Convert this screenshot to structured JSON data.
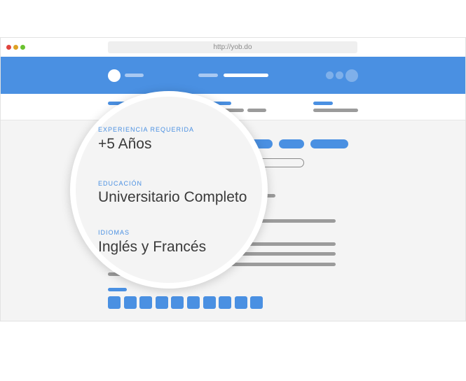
{
  "browser": {
    "url": "http://yob.do",
    "controls": {
      "close": "#e0443e",
      "minimize": "#dea123",
      "maximize": "#6ac22f"
    }
  },
  "magnifier": {
    "fields": [
      {
        "label": "EXPERIENCIA REQUERIDA",
        "value": "+5 Años"
      },
      {
        "label": "EDUCACIÓN",
        "value": "Universitario Completo"
      },
      {
        "label": "IDIOMAS",
        "value": "Inglés y Francés"
      }
    ]
  },
  "colors": {
    "accent": "#4a90e2"
  }
}
